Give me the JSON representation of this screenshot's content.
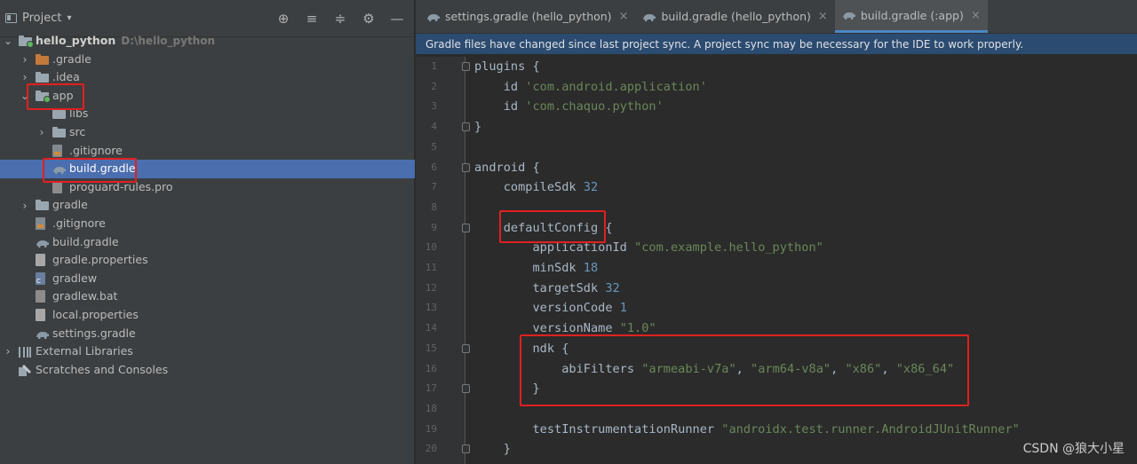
{
  "project_panel": {
    "title": "Project",
    "dropdown_glyph": "▾",
    "tools": [
      "⊕",
      "≡",
      "≑",
      "⚙",
      "—"
    ],
    "tree": [
      {
        "label": "hello_python",
        "hint": "D:\\hello_python",
        "depth": 0,
        "chevron": "⌄",
        "icon": "folder-module",
        "bold": true
      },
      {
        "label": ".gradle",
        "depth": 1,
        "chevron": "›",
        "icon": "folder-orange"
      },
      {
        "label": ".idea",
        "depth": 1,
        "chevron": "›",
        "icon": "folder"
      },
      {
        "label": "app",
        "depth": 1,
        "chevron": "⌄",
        "icon": "folder-module"
      },
      {
        "label": "libs",
        "depth": 2,
        "chevron": "",
        "icon": "folder"
      },
      {
        "label": "src",
        "depth": 2,
        "chevron": "›",
        "icon": "folder"
      },
      {
        "label": ".gitignore",
        "depth": 2,
        "chevron": "",
        "icon": "file-git"
      },
      {
        "label": "build.gradle",
        "depth": 2,
        "chevron": "",
        "icon": "gradle",
        "selected": true
      },
      {
        "label": "proguard-rules.pro",
        "depth": 2,
        "chevron": "",
        "icon": "file"
      },
      {
        "label": "gradle",
        "depth": 1,
        "chevron": "›",
        "icon": "folder"
      },
      {
        "label": ".gitignore",
        "depth": 1,
        "chevron": "",
        "icon": "file-git"
      },
      {
        "label": "build.gradle",
        "depth": 1,
        "chevron": "",
        "icon": "gradle"
      },
      {
        "label": "gradle.properties",
        "depth": 1,
        "chevron": "",
        "icon": "file-props"
      },
      {
        "label": "gradlew",
        "depth": 1,
        "chevron": "",
        "icon": "file-cmd"
      },
      {
        "label": "gradlew.bat",
        "depth": 1,
        "chevron": "",
        "icon": "file"
      },
      {
        "label": "local.properties",
        "depth": 1,
        "chevron": "",
        "icon": "file-props"
      },
      {
        "label": "settings.gradle",
        "depth": 1,
        "chevron": "",
        "icon": "gradle"
      },
      {
        "label": "External Libraries",
        "depth": 0,
        "chevron": "›",
        "icon": "libs"
      },
      {
        "label": "Scratches and Consoles",
        "depth": 0,
        "chevron": "",
        "icon": "scratch"
      }
    ]
  },
  "editor": {
    "tabs": [
      {
        "label": "settings.gradle (hello_python)",
        "active": false
      },
      {
        "label": "build.gradle (hello_python)",
        "active": false
      },
      {
        "label": "build.gradle (:app)",
        "active": true
      }
    ],
    "close_glyph": "×",
    "banner": "Gradle files have changed since last project sync. A project sync may be necessary for the IDE to work properly.",
    "lines": [
      {
        "n": "1",
        "fold": true,
        "parts": [
          [
            "plugins {",
            ""
          ]
        ]
      },
      {
        "n": "2",
        "fold": false,
        "parts": [
          [
            "    id ",
            ""
          ],
          [
            "'com.android.application'",
            "str"
          ]
        ]
      },
      {
        "n": "3",
        "fold": false,
        "parts": [
          [
            "    id ",
            ""
          ],
          [
            "'com.chaquo.python'",
            "str"
          ]
        ]
      },
      {
        "n": "4",
        "fold": true,
        "parts": [
          [
            "}",
            ""
          ]
        ]
      },
      {
        "n": "5",
        "fold": false,
        "parts": [
          [
            "",
            ""
          ]
        ]
      },
      {
        "n": "6",
        "fold": true,
        "parts": [
          [
            "android {",
            ""
          ]
        ]
      },
      {
        "n": "7",
        "fold": false,
        "parts": [
          [
            "    compileSdk ",
            ""
          ],
          [
            "32",
            "num"
          ]
        ]
      },
      {
        "n": "8",
        "fold": false,
        "parts": [
          [
            "",
            ""
          ]
        ]
      },
      {
        "n": "9",
        "fold": true,
        "parts": [
          [
            "    defaultConfig {",
            ""
          ]
        ]
      },
      {
        "n": "10",
        "fold": false,
        "parts": [
          [
            "        applicationId ",
            ""
          ],
          [
            "\"com.example.hello_python\"",
            "str"
          ]
        ]
      },
      {
        "n": "11",
        "fold": false,
        "parts": [
          [
            "        minSdk ",
            ""
          ],
          [
            "18",
            "num"
          ]
        ]
      },
      {
        "n": "12",
        "fold": false,
        "parts": [
          [
            "        targetSdk ",
            ""
          ],
          [
            "32",
            "num"
          ]
        ]
      },
      {
        "n": "13",
        "fold": false,
        "parts": [
          [
            "        versionCode ",
            ""
          ],
          [
            "1",
            "num"
          ]
        ]
      },
      {
        "n": "14",
        "fold": false,
        "parts": [
          [
            "        versionName ",
            ""
          ],
          [
            "\"1.0\"",
            "str"
          ]
        ]
      },
      {
        "n": "15",
        "fold": true,
        "parts": [
          [
            "        ndk {",
            ""
          ]
        ]
      },
      {
        "n": "16",
        "fold": false,
        "parts": [
          [
            "            abiFilters ",
            ""
          ],
          [
            "\"armeabi-v7a\"",
            "str"
          ],
          [
            ", ",
            ""
          ],
          [
            "\"arm64-v8a\"",
            "str"
          ],
          [
            ", ",
            ""
          ],
          [
            "\"x86\"",
            "str"
          ],
          [
            ", ",
            ""
          ],
          [
            "\"x86_64\"",
            "str"
          ]
        ]
      },
      {
        "n": "17",
        "fold": true,
        "parts": [
          [
            "        }",
            ""
          ]
        ]
      },
      {
        "n": "18",
        "fold": false,
        "parts": [
          [
            "",
            ""
          ]
        ]
      },
      {
        "n": "19",
        "fold": false,
        "parts": [
          [
            "        testInstrumentationRunner ",
            ""
          ],
          [
            "\"androidx.test.runner.AndroidJUnitRunner\"",
            "str"
          ]
        ]
      },
      {
        "n": "20",
        "fold": true,
        "parts": [
          [
            "    }",
            ""
          ]
        ]
      }
    ]
  },
  "watermark": "CSDN @狼大小星",
  "colors": {
    "highlight_box": "#e02020",
    "selection": "#4b6eaf",
    "banner": "#2b4b70"
  }
}
